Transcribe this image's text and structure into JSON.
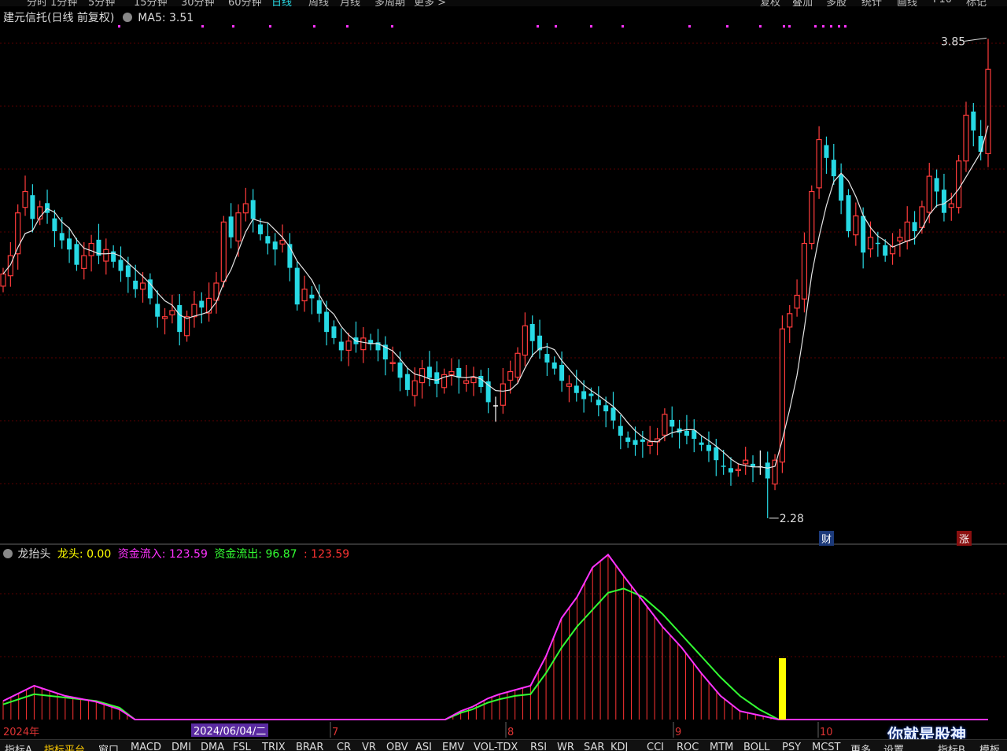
{
  "colors": {
    "up": "#ff3b3b",
    "down": "#27d9e4",
    "flat": "#ffffff",
    "ma": "#e6e6e6",
    "grid": "#5a0000",
    "inflow": "#ff33ff",
    "outflow": "#33ff33",
    "dragon": "#ffff00",
    "bars": "#ff3333"
  },
  "periods": [
    "分时",
    "1分钟",
    "5分钟",
    "15分钟",
    "30分钟",
    "60分钟",
    "日线",
    "周线",
    "月线",
    "多周期",
    "更多 >"
  ],
  "top_actions": [
    "复权",
    "叠加",
    "多股",
    "统计",
    "画线",
    "F10",
    "标记"
  ],
  "header": {
    "stock": "建元信托(日线 前复权)",
    "ma_label": "MA5: 3.51"
  },
  "annotations": {
    "high": "3.85",
    "low": "2.28",
    "cai": "财",
    "zhang": "涨"
  },
  "indicator": {
    "name": "龙抬头",
    "dragon": "龙头: 0.00",
    "inflow": "资金流入: 123.59",
    "outflow": "资金流出: 96.87",
    "extra": ": 123.59"
  },
  "timeline": {
    "start": "2024年",
    "cursor": "2024/06/04/二",
    "months": [
      "7",
      "8",
      "9",
      "10"
    ]
  },
  "tabs": [
    "指标A",
    "指标平台",
    "窗口",
    "MACD",
    "DMI",
    "DMA",
    "FSL",
    "TRIX",
    "BRAR",
    "CR",
    "VR",
    "OBV",
    "ASI",
    "EMV",
    "VOL-TDX",
    "RSI",
    "WR",
    "SAR",
    "KDJ",
    "CCI",
    "ROC",
    "MTM",
    "BOLL",
    "PSY",
    "MCST",
    "更多",
    "设置",
    "指标B",
    "模板"
  ],
  "watermark": "你就是股神",
  "chart_data": [
    {
      "type": "candlestick",
      "title": "建元信托(日线 前复权)",
      "price_range": [
        2.2,
        3.9
      ],
      "high_label": 3.85,
      "low_label": 2.28,
      "ma5_last": 3.51,
      "closes": [
        3.08,
        3.14,
        3.28,
        3.35,
        3.26,
        3.3,
        3.28,
        3.22,
        3.19,
        3.16,
        3.11,
        3.14,
        3.18,
        3.14,
        3.16,
        3.12,
        3.09,
        3.07,
        3.03,
        3.05,
        3.0,
        2.94,
        2.94,
        2.96,
        2.89,
        2.94,
        2.98,
        2.97,
        3.0,
        3.05,
        3.25,
        3.2,
        3.28,
        3.31,
        3.26,
        3.21,
        3.18,
        3.16,
        3.19,
        3.1,
        2.98,
        3.03,
        3.0,
        2.95,
        2.89,
        2.87,
        2.83,
        2.86,
        2.85,
        2.87,
        2.85,
        2.83,
        2.8,
        2.79,
        2.74,
        2.7,
        2.73,
        2.77,
        2.74,
        2.72,
        2.75,
        2.76,
        2.74,
        2.73,
        2.74,
        2.71,
        2.66,
        2.65,
        2.72,
        2.76,
        2.82,
        2.91,
        2.86,
        2.83,
        2.79,
        2.77,
        2.73,
        2.72,
        2.69,
        2.67,
        2.68,
        2.65,
        2.63,
        2.6,
        2.55,
        2.53,
        2.52,
        2.53,
        2.53,
        2.54,
        2.62,
        2.58,
        2.56,
        2.55,
        2.54,
        2.52,
        2.5,
        2.47,
        2.45,
        2.43,
        2.44,
        2.47,
        2.45,
        2.45,
        2.41,
        2.47,
        2.9,
        2.95,
        3.01,
        3.18,
        3.35,
        3.52,
        3.46,
        3.4,
        3.32,
        3.22,
        3.27,
        3.15,
        3.2,
        3.18,
        3.14,
        3.17,
        3.2,
        3.25,
        3.22,
        3.3,
        3.4,
        3.35,
        3.28,
        3.31,
        3.45,
        3.6,
        3.55,
        3.48,
        3.75
      ]
    },
    {
      "type": "line",
      "title": "龙抬头",
      "series": [
        {
          "name": "资金流入",
          "x": [
            0,
            8,
            16,
            24,
            30,
            34,
            40,
            46,
            54,
            62,
            72,
            82,
            92,
            100,
            104,
            108,
            112,
            114,
            118,
            121,
            125,
            128,
            132,
            136,
            140,
            144,
            148,
            152,
            156,
            160,
            165,
            170,
            175,
            180,
            185,
            190,
            195,
            200,
            206,
            212,
            218,
            224,
            230,
            236,
            242,
            248,
            254
          ],
          "values": [
            22,
            40,
            28,
            21,
            12,
            0,
            0,
            0,
            0,
            0,
            0,
            0,
            0,
            0,
            0,
            0,
            0,
            0,
            10,
            15,
            25,
            30,
            35,
            40,
            75,
            120,
            145,
            180,
            195,
            170,
            140,
            110,
            85,
            55,
            28,
            10,
            5,
            0,
            0,
            0,
            0,
            0,
            0,
            0,
            0,
            0,
            0
          ]
        },
        {
          "name": "资金流出",
          "x": [
            0,
            8,
            16,
            24,
            30,
            34,
            40,
            46,
            54,
            62,
            72,
            82,
            92,
            100,
            104,
            108,
            112,
            114,
            118,
            121,
            125,
            128,
            132,
            136,
            140,
            144,
            148,
            152,
            156,
            160,
            165,
            170,
            175,
            180,
            185,
            190,
            195,
            200,
            206,
            212,
            218,
            224,
            230,
            236,
            242,
            248,
            254
          ],
          "values": [
            18,
            30,
            26,
            22,
            14,
            0,
            0,
            0,
            0,
            0,
            0,
            0,
            0,
            0,
            0,
            0,
            0,
            0,
            8,
            12,
            20,
            24,
            28,
            30,
            55,
            85,
            110,
            130,
            150,
            155,
            145,
            125,
            100,
            75,
            50,
            28,
            12,
            0,
            0,
            0,
            0,
            0,
            0,
            0,
            0,
            0,
            0
          ]
        },
        {
          "name": "龙头",
          "values": [
            0
          ]
        }
      ]
    }
  ]
}
